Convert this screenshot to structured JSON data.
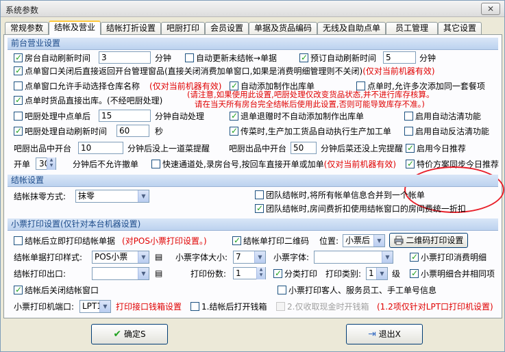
{
  "window": {
    "title": "系统参数",
    "close": "✕"
  },
  "tabs": [
    "常规参数",
    "结帐及营业",
    "结帐打折设置",
    "吧厨打印",
    "会员设置",
    "单据及货品编码",
    "无线及自助点单",
    "员工管理",
    "其它设置"
  ],
  "front": {
    "header": "前台营业设置",
    "room_refresh": {
      "label": "房台自动刷新时间",
      "value": "3",
      "unit": "分钟",
      "checked": true
    },
    "auto_update_bills": {
      "label": "自动更新未结帐→单据",
      "checked": false
    },
    "reserve_refresh": {
      "label": "预订自动刷新时间",
      "value": "5",
      "unit": "分钟",
      "checked": true
    },
    "close_order_window": {
      "label": "点单窗口关闭后直接返回开台管理窗品(直接关闭消费加单窗口,如果是消费明细管理则不关闭)",
      "note": "(仅对当前机器有效)",
      "checked": true
    },
    "choose_warehouse": {
      "label": "点单窗口允许手动选择仓库名称",
      "note": "(仅对当前机器有效)",
      "checked": false
    },
    "auto_make_in": {
      "label": "自动添加制作出库单",
      "checked": true
    },
    "allow_multi_set": {
      "label": "点单时,允许多次添加同一套餐项",
      "checked": false
    },
    "direct_out": {
      "label": "点单时货品直接出库。(不经吧厨处理)",
      "checked": true
    },
    "warning1": "(请注意,如果使用此设置,吧厨处理仅改变货品状态,并不进行库存核算。",
    "warning2": "请在当天所有房台完全结帐后使用此设置,否则可能导致库存不准。)",
    "kitchen_add_midbill": {
      "label": "吧厨处理中点单后",
      "value": "15",
      "unit": "分钟自动处理",
      "checked": false
    },
    "return_gift_out": {
      "label": "退单退赠时不自动添加制作出库单",
      "checked": true
    },
    "auto_clear": {
      "label": "启用自动沽清功能",
      "checked": false
    },
    "kitchen_refresh": {
      "label": "吧厨处理自动刷新时间",
      "value": "60",
      "unit": "秒",
      "checked": true
    },
    "pass_dish": {
      "label": "传菜时,生产加工货品自动执行生产加工单",
      "checked": true
    },
    "auto_unclear": {
      "label": "启用自动反沽清功能",
      "checked": false
    },
    "kitchen_out_alert": {
      "label": "吧厨出品中开台",
      "value": "10",
      "unit": "分钟后没上一道菜提醒"
    },
    "kitchen_out_done": {
      "label": "吧厨出品中开台",
      "value": "50",
      "unit": "分钟后菜还没上完提醒"
    },
    "today_recommend": {
      "label": "启用今日推荐",
      "checked": true
    },
    "open_bill": {
      "label": "开单",
      "value": "30",
      "unit": "分钟后不允许撤单"
    },
    "quick_channel": {
      "label": "快速通道处,录房台号,按回车直接开单或加单",
      "note": "(仅对当前机器有效)",
      "checked": false
    },
    "special_sync": {
      "label": "特价方案同步今日推荐",
      "checked": true
    }
  },
  "checkout": {
    "header": "结帐设置",
    "rounding_label": "结帐抹零方式:",
    "rounding_value": "抹零",
    "group_merge": {
      "label": "团队结帐时,将所有帐单信息合并到一个帐单",
      "checked": false
    },
    "group_discount": {
      "label": "团队结帐时,房间费折扣使用结帐窗口的房间费统一折扣",
      "checked": true
    }
  },
  "receipt": {
    "header": "小票打印设置(仅针对本台机器设置)",
    "print_after_checkout": {
      "label": "结帐后立即打印结帐单据",
      "note": "(对POS小票打印设置。)",
      "checked": false
    },
    "print_qr": {
      "label": "结帐单打印二维码",
      "checked": true
    },
    "position_label": "位置:",
    "position_value": "小票后",
    "qr_settings_btn": "二维码打印设置",
    "style_label": "结帐单据打印样式:",
    "style_value": "POS小票",
    "fontsize_label": "小票字体大小:",
    "fontsize_value": "7",
    "font_label": "小票字体:",
    "font_value": "",
    "print_detail": {
      "label": "小票打印消费明细",
      "checked": true
    },
    "port_label": "结帐打印出口:",
    "port_value": "",
    "copies_label": "打印份数:",
    "copies_value": "1",
    "category_print": {
      "label": "分类打印",
      "checked": true
    },
    "category_type_label": "打印类别:",
    "category_type_value": "1",
    "level": "级",
    "merge_same": {
      "label": "小票明细合并相同项",
      "checked": true
    },
    "close_after": {
      "label": "结帐后关闭结帐窗口",
      "checked": true
    },
    "print_guest": {
      "label": "小票打印客人、服务员工、手工单号信息",
      "checked": false
    },
    "printer_port_label": "小票打印机端口:",
    "printer_port_value": "LPT1",
    "cashbox_setting": "打印接口钱箱设置",
    "open_cashbox": {
      "label": "1.结帐后打开钱箱",
      "checked": false
    },
    "cash_only": {
      "label": "2.仅收取现金时开钱箱",
      "checked": false
    },
    "cashbox_note": "(1.2项仅针对LPT口打印机设置)"
  },
  "buttons": {
    "ok": "确定S",
    "exit": "退出X"
  }
}
